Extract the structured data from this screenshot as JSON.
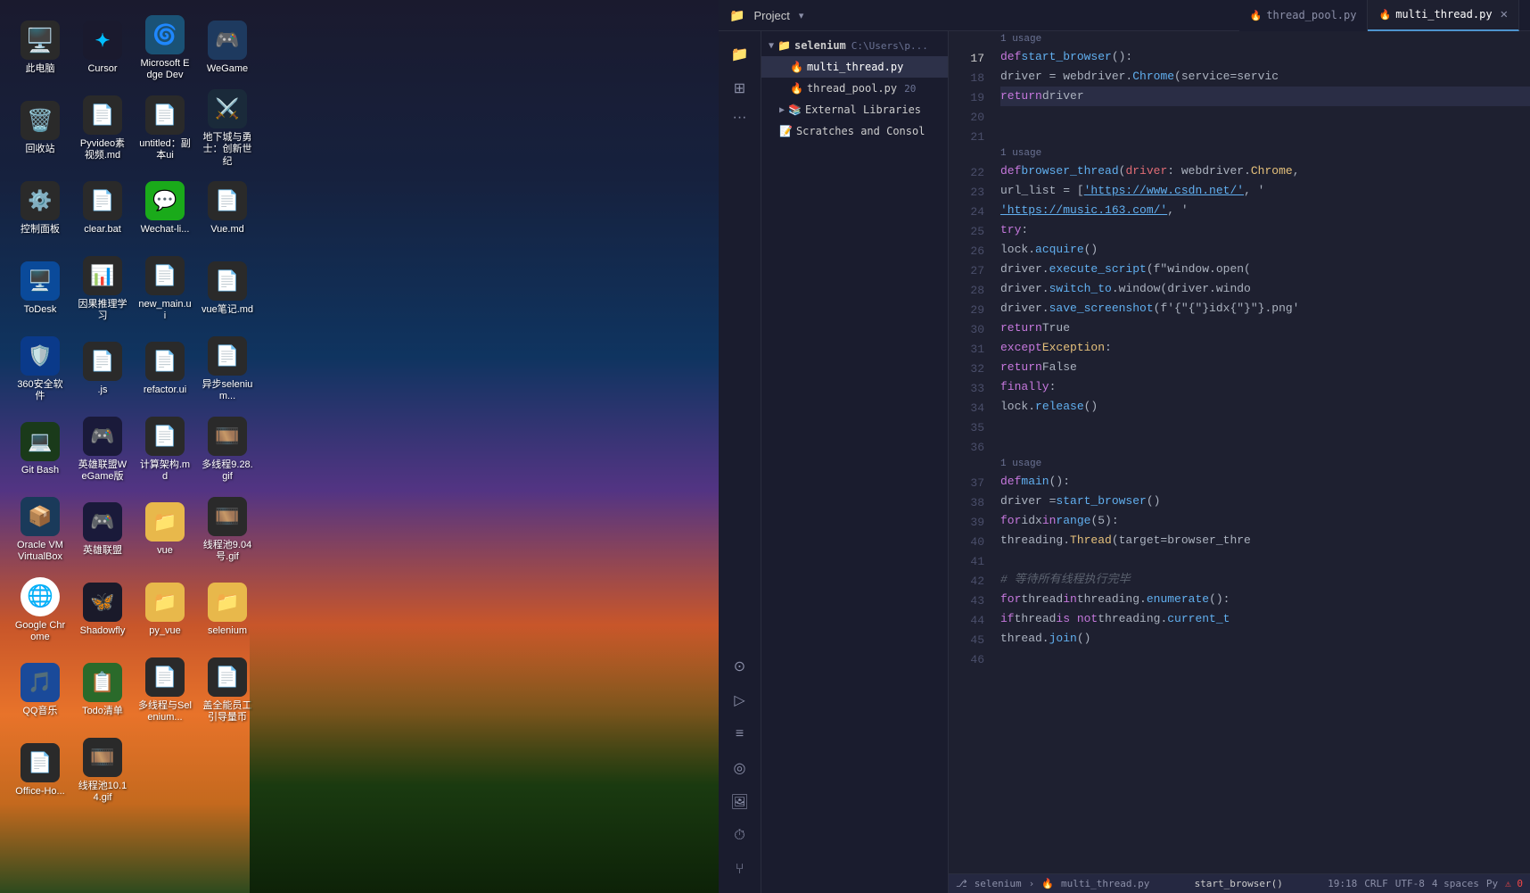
{
  "desktop": {
    "background": "space-night-sky",
    "icons": [
      {
        "id": "computer",
        "label": "此电脑",
        "emoji": "🖥️",
        "bg": "#2a2a2a"
      },
      {
        "id": "cursor",
        "label": "Cursor",
        "emoji": "✦",
        "bg": "#1a1a2e",
        "special": "cursor"
      },
      {
        "id": "edge-dev",
        "label": "Microsoft Edge Dev",
        "emoji": "🌀",
        "bg": "#1a5276"
      },
      {
        "id": "wegame",
        "label": "WeGame",
        "emoji": "🎮",
        "bg": "#1e3a5f"
      },
      {
        "id": "recycle",
        "label": "回收站",
        "emoji": "🗑️",
        "bg": "#2a2a2a"
      },
      {
        "id": "pyvideo",
        "label": "Pyvideo素视频.md",
        "emoji": "📄",
        "bg": "#2a2a2a"
      },
      {
        "id": "untitled",
        "label": "untitled：副本ui",
        "emoji": "📄",
        "bg": "#2a2a2a"
      },
      {
        "id": "dizhi",
        "label": "地下城与勇士：创新世纪",
        "emoji": "🎮",
        "bg": "#1a2a3a"
      },
      {
        "id": "control",
        "label": "控制面板",
        "emoji": "⚙️",
        "bg": "#2a2a2a"
      },
      {
        "id": "clearbat",
        "label": "clear.bat",
        "emoji": "📄",
        "bg": "#2a2a2a"
      },
      {
        "id": "wechat-li",
        "label": "Wechat-li...",
        "emoji": "💬",
        "bg": "#1aaa1a"
      },
      {
        "id": "vue-md",
        "label": "Vue.md",
        "emoji": "📄",
        "bg": "#2a2a2a"
      },
      {
        "id": "todesk",
        "label": "ToDesk",
        "emoji": "🖥️",
        "bg": "#0a4a9a"
      },
      {
        "id": "siwei",
        "label": "因果推理学习",
        "emoji": "📄",
        "bg": "#2a2a2a"
      },
      {
        "id": "new-main",
        "label": "new_main.ui",
        "emoji": "📄",
        "bg": "#2a2a2a"
      },
      {
        "id": "vue-notes",
        "label": "vue笔记.md",
        "emoji": "📄",
        "bg": "#2a2a2a"
      },
      {
        "id": "360",
        "label": "360安全软件",
        "emoji": "🛡️",
        "bg": "#0a3a8a"
      },
      {
        "id": "js",
        "label": ".js",
        "emoji": "📄",
        "bg": "#2a2a2a"
      },
      {
        "id": "refactor",
        "label": "refactor.ui",
        "emoji": "📄",
        "bg": "#2a2a2a"
      },
      {
        "id": "yibu-selenium",
        "label": "异步selenium...",
        "emoji": "📄",
        "bg": "#2a2a2a"
      },
      {
        "id": "gitbash",
        "label": "Git Bash",
        "emoji": "💻",
        "bg": "#1a3a1a"
      },
      {
        "id": "yingxiong-wegame",
        "label": "英雄联盟WeGame版",
        "emoji": "🎮",
        "bg": "#1a1a3a"
      },
      {
        "id": "jiagou-md",
        "label": "计算架构.md",
        "emoji": "📄",
        "bg": "#2a2a2a"
      },
      {
        "id": "duoxian-gif",
        "label": "多线程9.28.gif",
        "emoji": "🎞️",
        "bg": "#2a2a2a"
      },
      {
        "id": "oracle-vm",
        "label": "Oracle VM VirtualBox",
        "emoji": "📦",
        "bg": "#1a3a5a"
      },
      {
        "id": "yingxiong",
        "label": "英雄联盟",
        "emoji": "🎮",
        "bg": "#1a1a3a"
      },
      {
        "id": "vue-folder",
        "label": "vue",
        "emoji": "📁",
        "bg": "#e8b84b"
      },
      {
        "id": "xianchi-gif",
        "label": "线程池9.04号.gif",
        "emoji": "🎞️",
        "bg": "#2a2a2a"
      },
      {
        "id": "google-chrome",
        "label": "Google Chrome",
        "emoji": "🌐",
        "bg": "#ffffff"
      },
      {
        "id": "shadowfly",
        "label": "Shadowfly",
        "emoji": "🦋",
        "bg": "#1a1a2a"
      },
      {
        "id": "py-vue",
        "label": "py_vue",
        "emoji": "📁",
        "bg": "#e8b84b"
      },
      {
        "id": "selenium-folder",
        "label": "selenium",
        "emoji": "📁",
        "bg": "#e8b84b"
      },
      {
        "id": "qqmusic",
        "label": "QQ音乐",
        "emoji": "🎵",
        "bg": "#1a4a9a"
      },
      {
        "id": "todo",
        "label": "Todo清单",
        "emoji": "📋",
        "bg": "#2a6a2a"
      },
      {
        "id": "duoxian-selenium",
        "label": "多线程与Selenium...",
        "emoji": "📄",
        "bg": "#2a2a2a"
      },
      {
        "id": "quanneng",
        "label": "盖全能员工引导量币",
        "emoji": "📄",
        "bg": "#2a2a2a"
      },
      {
        "id": "office-ho",
        "label": "Office-Ho...",
        "emoji": "📄",
        "bg": "#2a2a2a"
      },
      {
        "id": "xianchi-1014",
        "label": "线程池10.14.gif",
        "emoji": "🎞️",
        "bg": "#2a2a2a"
      }
    ]
  },
  "ide": {
    "topbar": {
      "project_label": "Project",
      "chevron": "▾",
      "folder_icon": "📁"
    },
    "tabs": [
      {
        "id": "thread-pool",
        "label": "thread_pool.py",
        "icon": "🔥",
        "active": false
      },
      {
        "id": "multi-thread",
        "label": "multi_thread.py",
        "icon": "🔥",
        "active": true
      }
    ],
    "file_tree": {
      "root": "selenium",
      "root_path": "C:\\Users\\p...",
      "items": [
        {
          "level": 2,
          "name": "multi_thread.py",
          "icon": "py",
          "selected": true
        },
        {
          "level": 2,
          "name": "thread_pool.py",
          "icon": "py",
          "selected": false,
          "badge": "20"
        },
        {
          "level": 1,
          "name": "External Libraries",
          "icon": "folder",
          "collapsed": true
        },
        {
          "level": 1,
          "name": "Scratches and Consol",
          "icon": "file",
          "collapsed": true
        }
      ]
    },
    "code": {
      "filename": "multi_thread.py",
      "lines": [
        {
          "num": 17,
          "content": "",
          "type": "usage",
          "usage_text": "1 usage"
        },
        {
          "num": 17,
          "tokens": [
            {
              "t": "kw",
              "v": "def "
            },
            {
              "t": "fn",
              "v": "start_browser"
            },
            {
              "t": "plain",
              "v": "():"
            }
          ]
        },
        {
          "num": 18,
          "tokens": [
            {
              "t": "plain",
              "v": "    driver = webdriver."
            },
            {
              "t": "fn",
              "v": "Chrome"
            },
            {
              "t": "plain",
              "v": "(service=servic"
            }
          ]
        },
        {
          "num": 19,
          "tokens": [
            {
              "t": "kw",
              "v": "    return "
            },
            {
              "t": "plain",
              "v": "driver"
            }
          ]
        },
        {
          "num": 20,
          "tokens": []
        },
        {
          "num": 21,
          "tokens": []
        },
        {
          "num": null,
          "type": "usage",
          "usage_text": "1 usage"
        },
        {
          "num": 22,
          "tokens": [
            {
              "t": "kw",
              "v": "def "
            },
            {
              "t": "fn",
              "v": "browser_thread"
            },
            {
              "t": "plain",
              "v": "("
            },
            {
              "t": "param",
              "v": "driver"
            },
            {
              "t": "plain",
              "v": ": webdriver."
            },
            {
              "t": "cls",
              "v": "Chrome"
            },
            {
              "t": "plain",
              "v": ","
            }
          ]
        },
        {
          "num": 23,
          "tokens": [
            {
              "t": "plain",
              "v": "    url_list = ["
            },
            {
              "t": "link",
              "v": "'https://www.csdn.net/'"
            },
            {
              "t": "plain",
              "v": ", '"
            }
          ]
        },
        {
          "num": 24,
          "tokens": [
            {
              "t": "plain",
              "v": "                "
            },
            {
              "t": "link",
              "v": "'https://music.163.com/'"
            },
            {
              "t": "plain",
              "v": ", '"
            }
          ]
        },
        {
          "num": 25,
          "tokens": [
            {
              "t": "plain",
              "v": "    "
            },
            {
              "t": "kw",
              "v": "try"
            },
            {
              "t": "plain",
              "v": ":"
            }
          ]
        },
        {
          "num": 26,
          "tokens": [
            {
              "t": "plain",
              "v": "        lock."
            },
            {
              "t": "fn",
              "v": "acquire"
            },
            {
              "t": "plain",
              "v": "()"
            }
          ]
        },
        {
          "num": 27,
          "tokens": [
            {
              "t": "plain",
              "v": "        driver."
            },
            {
              "t": "fn",
              "v": "execute_script"
            },
            {
              "t": "plain",
              "v": "(f\"window.open("
            }
          ]
        },
        {
          "num": 28,
          "tokens": [
            {
              "t": "plain",
              "v": "        driver."
            },
            {
              "t": "fn",
              "v": "switch_to"
            },
            {
              "t": "plain",
              "v": ".window(driver.windo"
            }
          ]
        },
        {
          "num": 29,
          "tokens": [
            {
              "t": "plain",
              "v": "        driver."
            },
            {
              "t": "fn",
              "v": "save_screenshot"
            },
            {
              "t": "plain",
              "v": "(f'{idx}.png'"
            }
          ]
        },
        {
          "num": 30,
          "tokens": [
            {
              "t": "kw",
              "v": "        return "
            },
            {
              "t": "plain",
              "v": "True"
            }
          ]
        },
        {
          "num": 31,
          "tokens": [
            {
              "t": "kw",
              "v": "    except "
            },
            {
              "t": "cls",
              "v": "Exception"
            },
            {
              "t": "plain",
              "v": ":"
            }
          ]
        },
        {
          "num": 32,
          "tokens": [
            {
              "t": "kw",
              "v": "        return "
            },
            {
              "t": "plain",
              "v": "False"
            }
          ]
        },
        {
          "num": 33,
          "tokens": [
            {
              "t": "kw",
              "v": "    finally"
            },
            {
              "t": "plain",
              "v": ":"
            }
          ]
        },
        {
          "num": 34,
          "tokens": [
            {
              "t": "plain",
              "v": "        lock."
            },
            {
              "t": "fn",
              "v": "release"
            },
            {
              "t": "plain",
              "v": "()"
            }
          ]
        },
        {
          "num": 35,
          "tokens": []
        },
        {
          "num": 36,
          "tokens": []
        },
        {
          "num": null,
          "type": "usage",
          "usage_text": "1 usage"
        },
        {
          "num": 37,
          "tokens": [
            {
              "t": "kw",
              "v": "def "
            },
            {
              "t": "fn",
              "v": "main"
            },
            {
              "t": "plain",
              "v": "():"
            }
          ]
        },
        {
          "num": 38,
          "tokens": [
            {
              "t": "plain",
              "v": "    driver = "
            },
            {
              "t": "fn",
              "v": "start_browser"
            },
            {
              "t": "plain",
              "v": "()"
            }
          ]
        },
        {
          "num": 39,
          "tokens": [
            {
              "t": "kw",
              "v": "    for "
            },
            {
              "t": "plain",
              "v": "idx "
            },
            {
              "t": "kw",
              "v": "in "
            },
            {
              "t": "fn",
              "v": "range"
            },
            {
              "t": "plain",
              "v": "(5):"
            }
          ]
        },
        {
          "num": 40,
          "tokens": [
            {
              "t": "plain",
              "v": "        threading."
            },
            {
              "t": "cls",
              "v": "Thread"
            },
            {
              "t": "plain",
              "v": "(target=browser_thre"
            }
          ]
        },
        {
          "num": 41,
          "tokens": []
        },
        {
          "num": 42,
          "tokens": [
            {
              "t": "comment",
              "v": "    # 等待所有线程执行完毕"
            }
          ]
        },
        {
          "num": 43,
          "tokens": [
            {
              "t": "kw",
              "v": "    for "
            },
            {
              "t": "plain",
              "v": "thread "
            },
            {
              "t": "kw",
              "v": "in "
            },
            {
              "t": "plain",
              "v": "threading."
            },
            {
              "t": "fn",
              "v": "enumerate"
            },
            {
              "t": "plain",
              "v": "():"
            }
          ]
        },
        {
          "num": 44,
          "tokens": [
            {
              "t": "kw",
              "v": "        if "
            },
            {
              "t": "plain",
              "v": "thread "
            },
            {
              "t": "kw",
              "v": "is not "
            },
            {
              "t": "plain",
              "v": "threading."
            },
            {
              "t": "fn",
              "v": "current_t"
            }
          ]
        },
        {
          "num": 45,
          "tokens": [
            {
              "t": "plain",
              "v": "            thread."
            },
            {
              "t": "fn",
              "v": "join"
            },
            {
              "t": "plain",
              "v": "()"
            }
          ]
        },
        {
          "num": 46,
          "tokens": []
        }
      ]
    },
    "status_bar": {
      "branch": "selenium",
      "file_path": "multi_thread.py",
      "cursor_pos": "19:18",
      "line_ending": "CRLF",
      "encoding": "UTF-8",
      "spaces": "4 spaces",
      "language": "Py",
      "errors": 0,
      "warnings": 0,
      "function_name": "start_browser()"
    },
    "sidebar_icons": [
      {
        "icon": "⊙",
        "name": "run-debug",
        "label": "Run/Debug"
      },
      {
        "icon": "▷",
        "name": "run",
        "label": "Run"
      },
      {
        "icon": "≡",
        "name": "layers",
        "label": "Layers"
      },
      {
        "icon": "◎",
        "name": "record",
        "label": "Record"
      },
      {
        "icon": "🖼",
        "name": "ui-designer",
        "label": "UI Designer"
      },
      {
        "icon": "⚠",
        "name": "problems",
        "label": "Problems"
      },
      {
        "icon": "⑂",
        "name": "vcs",
        "label": "VCS"
      }
    ]
  }
}
